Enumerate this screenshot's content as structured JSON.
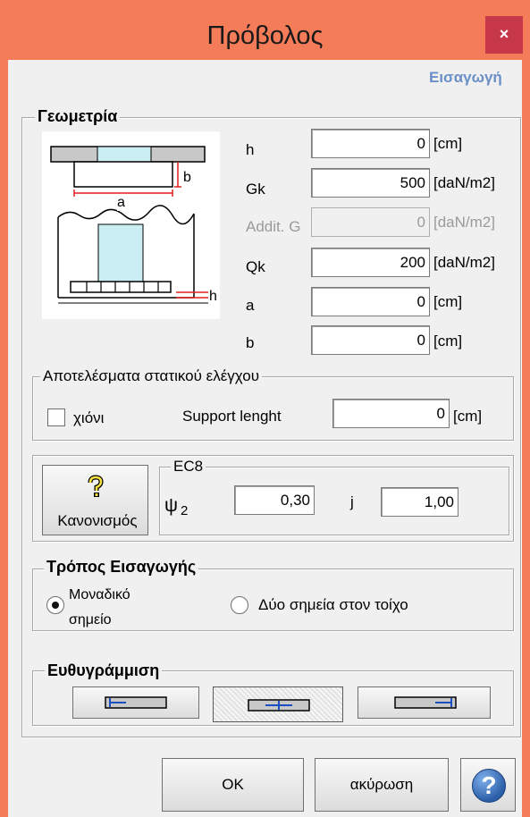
{
  "window": {
    "title": "Πρόβολος",
    "close_symbol": "×"
  },
  "header": {
    "entry_link": "Εισαγωγή"
  },
  "geometry": {
    "legend": "Γεωμετρία",
    "diagram_labels": {
      "b": "b",
      "a": "a",
      "h": "h"
    },
    "fields": [
      {
        "label": "h",
        "value": "0",
        "unit": "[cm]",
        "enabled": true
      },
      {
        "label": "Gk",
        "value": "500",
        "unit": "[daN/m2]",
        "enabled": true
      },
      {
        "label": "Addit. G",
        "value": "0",
        "unit": "[daN/m2]",
        "enabled": false
      },
      {
        "label": "Qk",
        "value": "200",
        "unit": "[daN/m2]",
        "enabled": true
      },
      {
        "label": "a",
        "value": "0",
        "unit": "[cm]",
        "enabled": true
      },
      {
        "label": "b",
        "value": "0",
        "unit": "[cm]",
        "enabled": true
      }
    ]
  },
  "results": {
    "legend": "Αποτελέσματα στατικού ελέγχου",
    "snow_label": "χιόνι",
    "snow_checked": false,
    "support_label": "Support lenght",
    "support_value": "0",
    "support_unit": "[cm]"
  },
  "ec8": {
    "regulations_button": "Κανονισμός",
    "legend": "EC8",
    "psi_label": "ψ",
    "psi_sub": "2",
    "psi_value": "0,30",
    "j_label": "j",
    "j_value": "1,00"
  },
  "input_mode": {
    "legend": "Τρόπος Εισαγωγής",
    "option1": "Μοναδικό σημείο",
    "option2": "Δύο σημεία στον τοίχο",
    "selected": "option1"
  },
  "alignment": {
    "legend": "Ευθυγράμμιση",
    "selected": "center"
  },
  "buttons": {
    "ok": "OK",
    "cancel": "ακύρωση",
    "help_symbol": "?"
  },
  "colors": {
    "frame": "#f57c59",
    "close": "#c7374a",
    "link": "#6a8fc7",
    "help": "#2b5ea8",
    "alignment_icon": "#1a4fc2"
  }
}
